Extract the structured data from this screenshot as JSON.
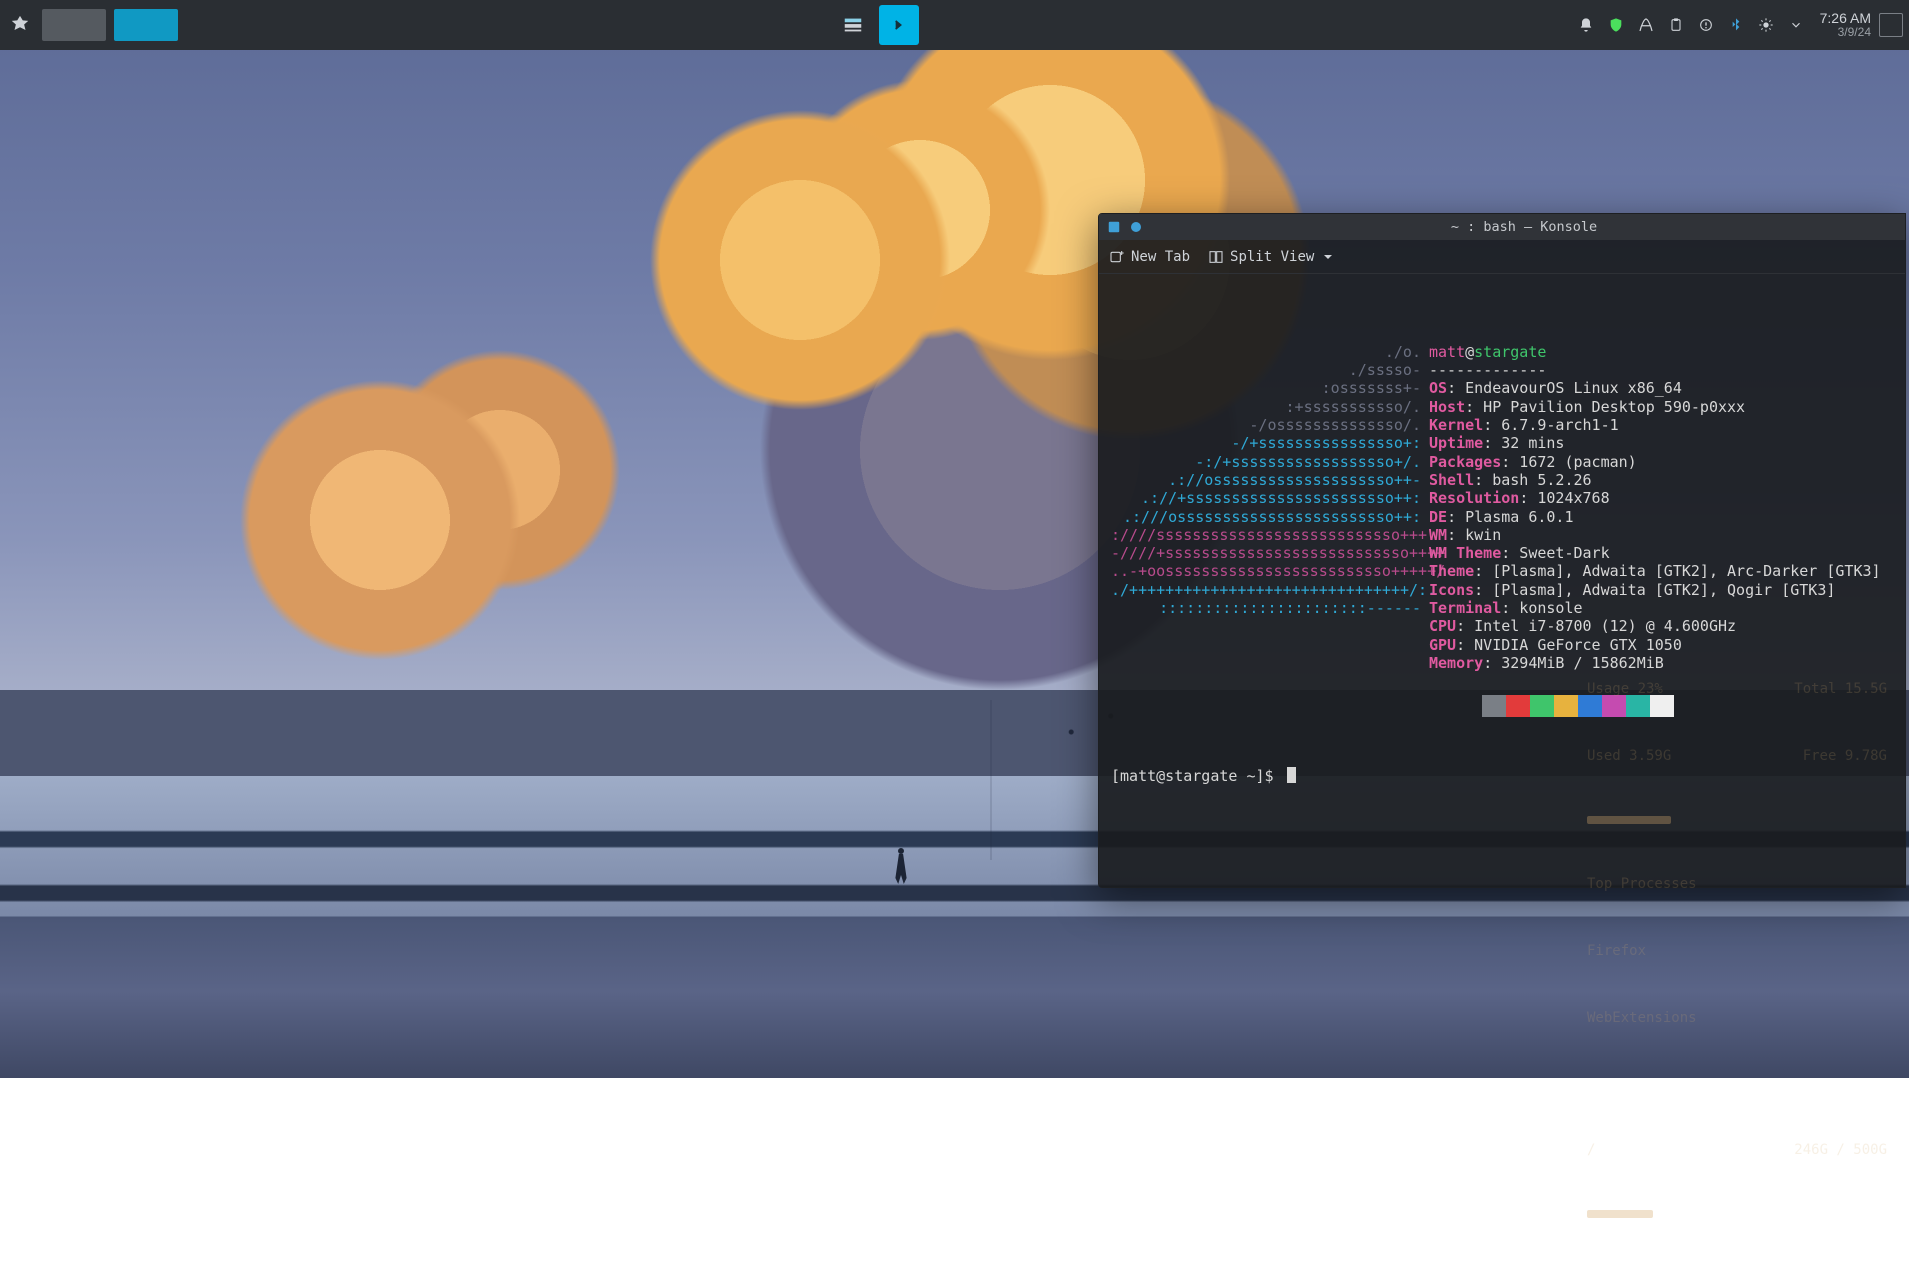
{
  "panel": {
    "clock_time": "7:26 AM",
    "clock_date": "3/9/24",
    "tray_icons": [
      "notifications",
      "shield",
      "keyboard",
      "clipboard",
      "updates",
      "bluetooth",
      "brightness",
      "chevron"
    ],
    "virtual_desktops": 2
  },
  "konsole": {
    "title": "~ : bash — Konsole",
    "toolbar": {
      "new_tab": "New Tab",
      "split_view": "Split View"
    },
    "ascii_art": [
      "./o.",
      "./sssso-",
      ":osssssss+-",
      ":+sssssssssso/.",
      "-/ossssssssssssso/.",
      "-/+ssssssssssssssso+:",
      "-:/+ssssssssssssssssso+/.",
      ".://ossssssssssssssssssso++-",
      ".://+sssssssssssssssssssssso++:",
      ".:///ossssssssssssssssssssssso++:",
      ":////sssssssssssssssssssssssssso+++.",
      "-////+sssssssssssssssssssssssssso++++",
      "..-+oosssssssssssssssssssssssso+++++/",
      "./+++++++++++++++++++++++++++++++/:.",
      ":::::::::::::::::::::::------"
    ],
    "user": "matt",
    "at": "@",
    "host": "stargate",
    "sep": "-------------",
    "fields": [
      {
        "k": "OS",
        "v": ": EndeavourOS Linux x86_64"
      },
      {
        "k": "Host",
        "v": ": HP Pavilion Desktop 590-p0xxx"
      },
      {
        "k": "Kernel",
        "v": ": 6.7.9-arch1-1"
      },
      {
        "k": "Uptime",
        "v": ": 32 mins"
      },
      {
        "k": "Packages",
        "v": ": 1672 (pacman)"
      },
      {
        "k": "Shell",
        "v": ": bash 5.2.26"
      },
      {
        "k": "Resolution",
        "v": ": 1024x768"
      },
      {
        "k": "DE",
        "v": ": Plasma 6.0.1"
      },
      {
        "k": "WM",
        "v": ": kwin"
      },
      {
        "k": "WM Theme",
        "v": ": Sweet-Dark"
      },
      {
        "k": "Theme",
        "v": ": [Plasma], Adwaita [GTK2], Arc-Darker [GTK3]"
      },
      {
        "k": "Icons",
        "v": ": [Plasma], Adwaita [GTK2], Qogir [GTK3]"
      },
      {
        "k": "Terminal",
        "v": ": konsole"
      },
      {
        "k": "CPU",
        "v": ": Intel i7-8700 (12) @ 4.600GHz"
      },
      {
        "k": "GPU",
        "v": ": NVIDIA GeForce GTX 1050"
      },
      {
        "k": "Memory",
        "v": ": 3294MiB / 15862MiB"
      }
    ],
    "swatches": [
      "#7a7f86",
      "#e23b3b",
      "#3fc56b",
      "#e7b23e",
      "#2f7bd6",
      "#c54bb0",
      "#29b5a5",
      "#efefef"
    ],
    "prompt": "[matt@stargate ~]$ "
  },
  "ghost": {
    "rows": [
      {
        "l": "Usage 23%",
        "r": "Total 15.5G"
      },
      {
        "l": "Used 3.59G",
        "r": "Free 9.78G"
      }
    ],
    "top": "Top Processes",
    "p1": "Firefox",
    "p2": "WebExtensions",
    "disk": {
      "l": "/",
      "r": "246G / 500G"
    }
  }
}
